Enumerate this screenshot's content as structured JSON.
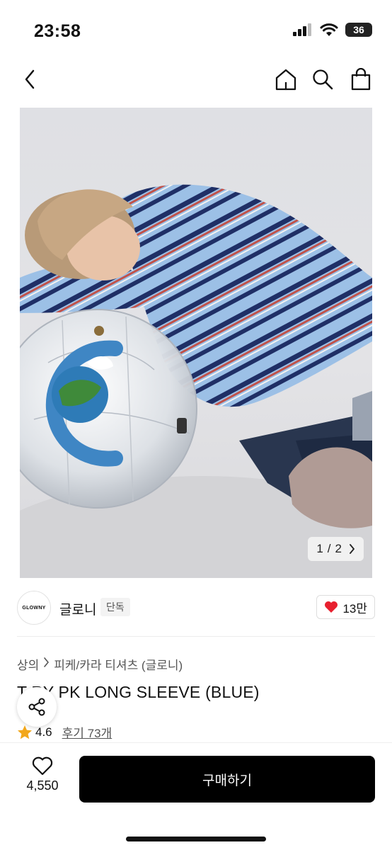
{
  "status": {
    "time": "23:58",
    "battery": "36"
  },
  "nav": {
    "back_icon": "chevron-left-icon",
    "home_icon": "home-icon",
    "search_icon": "search-icon",
    "bag_icon": "shopping-bag-icon"
  },
  "gallery": {
    "current": "1",
    "separator": "/",
    "total": "2"
  },
  "brand": {
    "logo_text": "GLOWNY",
    "name": "글로니",
    "badge": "단독",
    "likes": "13만",
    "accent": "#e8202f"
  },
  "breadcrumb": {
    "category": "상의",
    "subcategory": "피케/카라 티셔츠 (글로니)"
  },
  "product": {
    "title": "T  RY PK LONG SLEEVE (BLUE)",
    "rating": "4.6",
    "reviews": "후기 73개"
  },
  "footer": {
    "wish_count": "4,550",
    "buy_label": "구매하기"
  }
}
